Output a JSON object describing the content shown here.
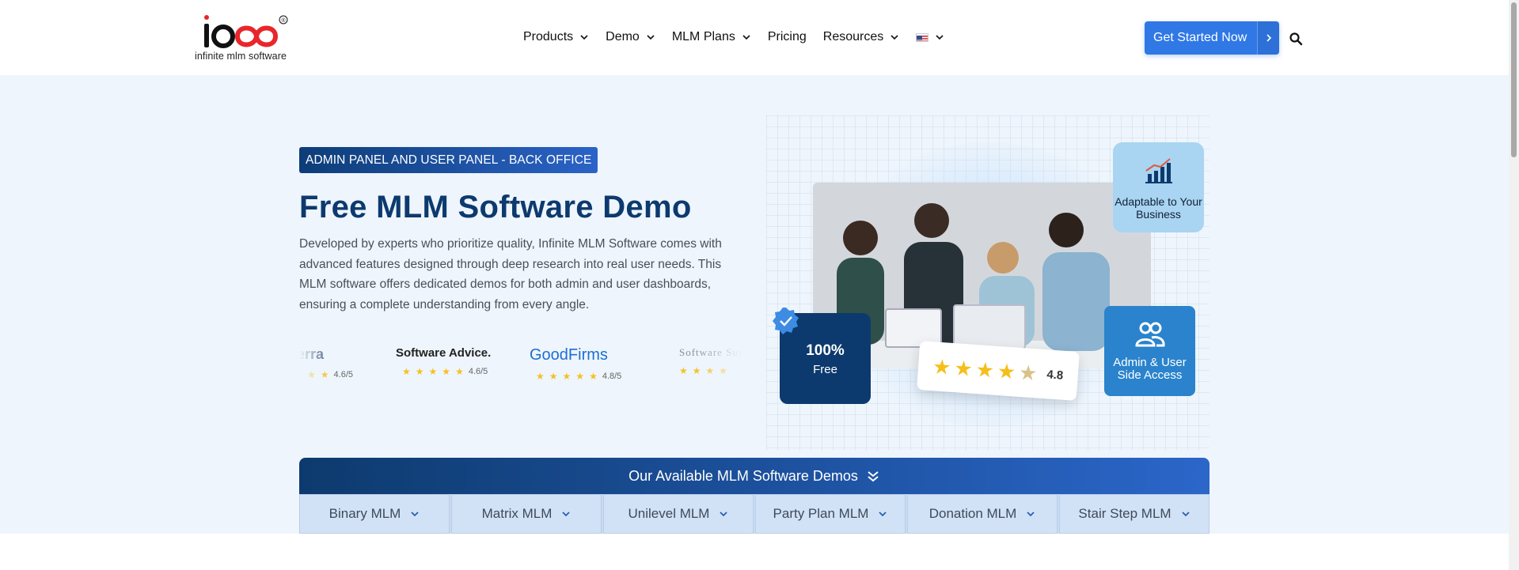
{
  "logo": {
    "text": "infinite mlm software",
    "mark": "1000",
    "registered": "®"
  },
  "nav": {
    "items": [
      {
        "label": "Products",
        "has_dropdown": true
      },
      {
        "label": "Demo",
        "has_dropdown": true
      },
      {
        "label": "MLM Plans",
        "has_dropdown": true
      },
      {
        "label": "Pricing",
        "has_dropdown": false
      },
      {
        "label": "Resources",
        "has_dropdown": true
      }
    ],
    "language_icon": "us-flag-icon"
  },
  "cta": {
    "label": "Get Started Now"
  },
  "hero": {
    "badge": "ADMIN PANEL AND USER PANEL - BACK OFFICE",
    "title": "Free MLM Software Demo",
    "description": "Developed by experts who prioritize quality, Infinite MLM Software comes with advanced features designed through deep research into real user needs. This MLM software offers dedicated demos for both admin and user dashboards, ensuring a complete understanding from every angle."
  },
  "reviews": [
    {
      "name": "apterra",
      "rating": "4.6/5",
      "color": "#4a5f80"
    },
    {
      "name": "Software Advice.",
      "rating": "4.6/5",
      "color": "#222222"
    },
    {
      "name": "GoodFirms",
      "rating": "4.8/5",
      "color": "#1c6ed6"
    },
    {
      "name": "Software Suggest",
      "rating": "",
      "color": "#8a8f99"
    }
  ],
  "illustration": {
    "free_card": {
      "big": "100%",
      "small": "Free"
    },
    "adapt_card": {
      "label": "Adaptable to Your Business"
    },
    "admin_card": {
      "label": "Admin & User Side Access"
    },
    "rating": {
      "stars": 5,
      "value": "4.8"
    }
  },
  "demos": {
    "heading": "Our Available MLM Software Demos",
    "tabs": [
      {
        "label": "Binary MLM"
      },
      {
        "label": "Matrix MLM"
      },
      {
        "label": "Unilevel MLM"
      },
      {
        "label": "Party Plan MLM"
      },
      {
        "label": "Donation MLM"
      },
      {
        "label": "Stair Step MLM"
      }
    ]
  },
  "colors": {
    "brand_dark": "#0d3a6e",
    "accent": "#2f78e6",
    "hero_bg": "#eef5fc",
    "tab_bg": "#d2e2f6"
  }
}
